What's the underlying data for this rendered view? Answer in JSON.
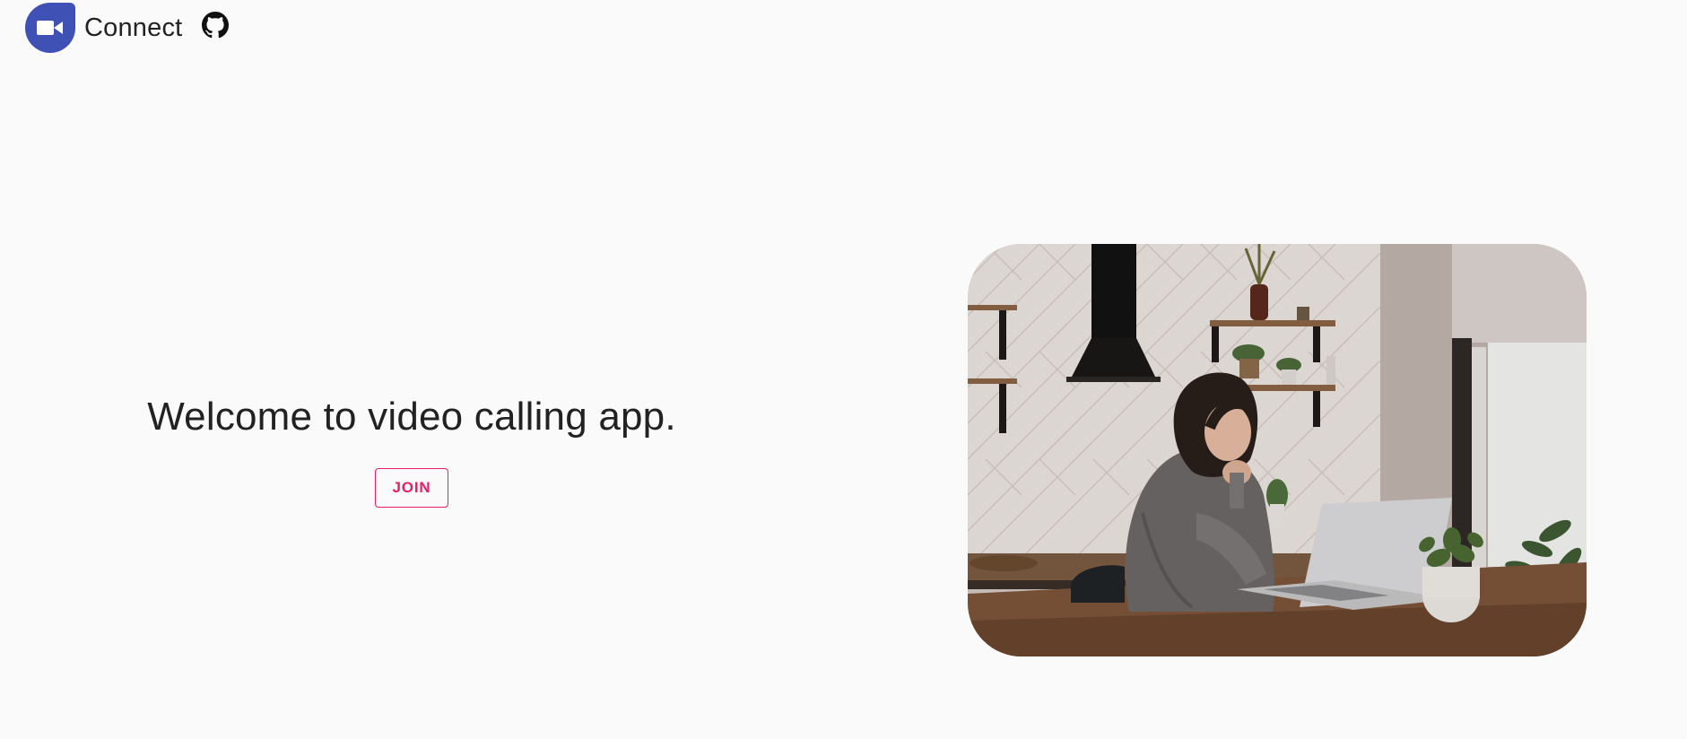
{
  "app": {
    "brand_name": "Connect",
    "logo_icon": "video-camera-icon",
    "github_icon": "github-icon",
    "accent_color": "#3f51b5"
  },
  "hero": {
    "welcome_text": "Welcome to video calling app.",
    "join_label": "JOIN",
    "join_color": "#e91e63"
  },
  "photo": {
    "subject": "hero-photo"
  }
}
